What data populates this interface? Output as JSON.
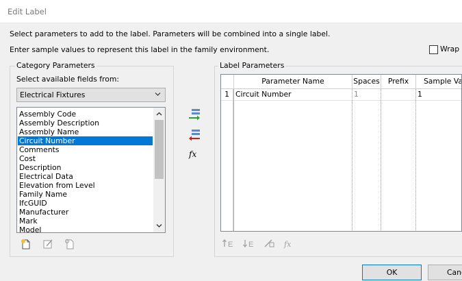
{
  "window": {
    "title": "Edit Label"
  },
  "instructions": {
    "line1": "Select parameters to add to the label.  Parameters will be combined into a single label.",
    "line2": "Enter sample values to represent this label in the family environment."
  },
  "wrap_checkbox": {
    "label": "Wrap b",
    "checked": false
  },
  "category_panel": {
    "title": "Category Parameters",
    "fields_label": "Select available fields from:",
    "category_value": "Electrical Fixtures",
    "fields": [
      "Assembly Code",
      "Assembly Description",
      "Assembly Name",
      "Circuit Number",
      "Comments",
      "Cost",
      "Description",
      "Electrical Data",
      "Elevation from Level",
      "Family Name",
      "IfcGUID",
      "Manufacturer",
      "Mark",
      "Model"
    ],
    "selected_field": "Circuit Number"
  },
  "label_panel": {
    "title": "Label Parameters",
    "columns": [
      "Parameter Name",
      "Spaces",
      "Prefix",
      "Sample Va"
    ],
    "rows": [
      {
        "index": "1",
        "parameter": "Circuit Number",
        "spaces": "1",
        "prefix": "",
        "sample": "1"
      }
    ]
  },
  "mid_buttons": {
    "formula_glyph": "fx"
  },
  "buttons": {
    "ok": "OK",
    "cancel": "Cance"
  },
  "colors": {
    "selection": "#0078d7",
    "add_arrow": "#2e9e2e",
    "remove_arrow": "#d11a1a"
  }
}
